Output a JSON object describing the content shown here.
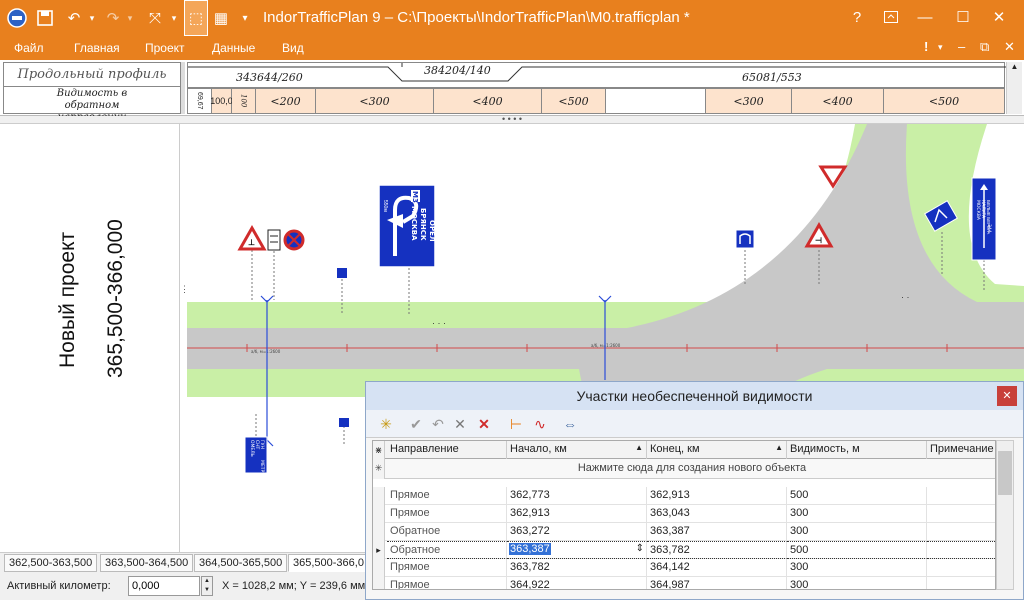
{
  "window": {
    "title": "IndorTrafficPlan 9 – C:\\Проекты\\IndorTrafficPlan\\M0.trafficplan *",
    "help": "?",
    "restore": "⧉",
    "minimize": "—",
    "maximize": "☐",
    "close": "✕"
  },
  "menu": {
    "items": [
      "Файл",
      "Главная",
      "Проект",
      "Данные",
      "Вид"
    ],
    "alert": "!"
  },
  "profile": {
    "left_row1": "Продольный профиль",
    "left_row2": "Видимость в обратном направлении",
    "top_segments": [
      "343644/260",
      "384204/140",
      "65081/553"
    ],
    "bottom_segments": [
      "<200",
      "<300",
      "<400",
      "<500",
      "<300",
      "<400",
      "<500"
    ],
    "small_labels": [
      "69,67",
      "100,0",
      "100"
    ]
  },
  "plan": {
    "project_name": "Новый проект",
    "range": "365,500-366,000",
    "sign_blue_big": {
      "top": "М3",
      "lines": [
        "МОСКВА",
        "БРЯНСК",
        "ОРЁЛ"
      ],
      "dist": "550м"
    },
    "sign_right": {
      "lines": [
        "КАЛУГА",
        "МОСКВА",
        "БЕЛЫЕ БЕРЕГА"
      ],
      "num": "344"
    },
    "sign_bottom_left": {
      "lines": [
        "ОМЕЛЬ",
        "СНТ",
        "ГУН",
        "МЕТР"
      ]
    },
    "small_text_1": "а/б, м=1:2600",
    "small_text_2": "а/б, м=1:2600"
  },
  "tabs": [
    "362,500-363,500",
    "363,500-364,500",
    "364,500-365,500",
    "365,500-366,0"
  ],
  "status": {
    "active_km_label": "Активный километр:",
    "active_km_value": "0,000",
    "coords": "X = 1028,2 мм; Y = 239,6 мм;"
  },
  "dialog": {
    "title": "Участки необеспеченной видимости",
    "columns": [
      "Направление",
      "Начало, км",
      "Конец, км",
      "Видимость, м",
      "Примечание"
    ],
    "new_row_text": "Нажмите сюда для создания нового объекта",
    "rows": [
      [
        "Прямое",
        "362,773",
        "362,913",
        "500",
        ""
      ],
      [
        "Прямое",
        "362,913",
        "363,043",
        "300",
        ""
      ],
      [
        "Обратное",
        "363,272",
        "363,387",
        "300",
        ""
      ],
      [
        "Обратное",
        "363,387",
        "363,782",
        "500",
        ""
      ],
      [
        "Прямое",
        "363,782",
        "364,142",
        "300",
        ""
      ],
      [
        "Прямое",
        "364,922",
        "364,987",
        "300",
        ""
      ]
    ]
  },
  "colors": {
    "accent": "#e8801e",
    "road": "#c8c8c8",
    "verge": "#c9efa6",
    "sign_blue": "#1531c0",
    "sign_red": "#d02b2b"
  }
}
